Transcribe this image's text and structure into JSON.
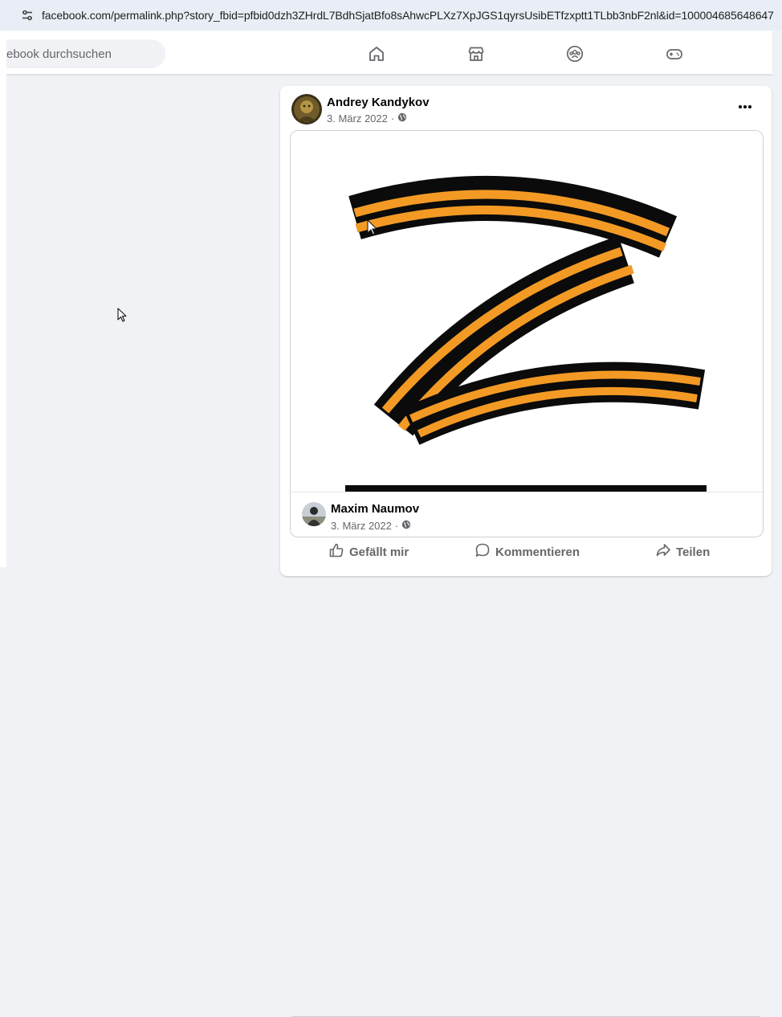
{
  "browser": {
    "url": "facebook.com/permalink.php?story_fbid=pfbid0dzh3ZHrdL7BdhSjatBfo8sAhwcPLXz7XpJGS1qyrsUsibETfzxptt1TLbb3nbF2nl&id=100004685648647",
    "site_info_icon": "tune-icon"
  },
  "facebook_nav": {
    "search_placeholder": "ebook durchsuchen",
    "icons": [
      "home-icon",
      "marketplace-icon",
      "groups-icon",
      "gaming-icon"
    ]
  },
  "post": {
    "author": "Andrey Kandykov",
    "date": "3. März 2022",
    "audience_icon": "globe-icon",
    "more_icon": "more-icon",
    "shared_post": {
      "image_description": "Z symbol in orange and black ribbon",
      "author": "Maxim Naumov",
      "date": "3. März 2022",
      "audience_icon": "globe-icon"
    },
    "actions": [
      {
        "label": "Gefällt mir",
        "icon": "like-icon"
      },
      {
        "label": "Kommentieren",
        "icon": "comment-icon"
      },
      {
        "label": "Teilen",
        "icon": "share-icon"
      }
    ]
  },
  "colors": {
    "ribbon_orange": "#f39a25",
    "ribbon_black": "#0b0b0b",
    "meta_gray": "#65676b",
    "page_bg": "#f0f2f5"
  }
}
